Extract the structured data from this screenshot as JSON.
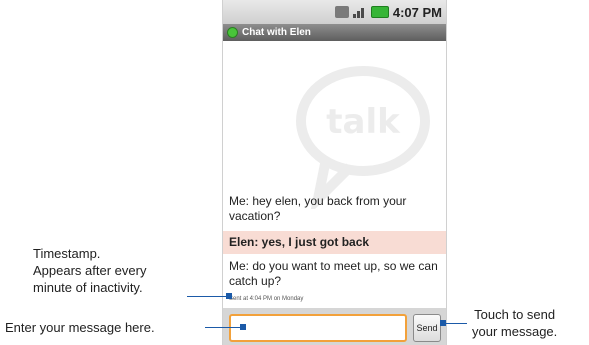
{
  "status_bar": {
    "time": "4:07 PM"
  },
  "title_bar": {
    "title": "Chat with Elen"
  },
  "watermark": {
    "text": "talk"
  },
  "messages": [
    {
      "text": "Me: hey elen, you back from your vacation?"
    },
    {
      "text": "Elen: yes, I just got back"
    },
    {
      "text": "Me: do you want to meet up, so we can catch up?"
    }
  ],
  "timestamp": "Sent at 4:04 PM on Monday",
  "input": {
    "value": "",
    "placeholder": ""
  },
  "send_button": {
    "label": "Send"
  },
  "callouts": {
    "timestamp_line1": "Timestamp.",
    "timestamp_line2": "Appears after every",
    "timestamp_line3": "minute of inactivity.",
    "enter": "Enter your message here.",
    "send_line1": "Touch to send",
    "send_line2": "your message."
  },
  "colors": {
    "highlight": "#f8dcd4",
    "input_focus": "#f2a13b",
    "leader": "#1b5aa8",
    "presence": "#49c43a"
  }
}
